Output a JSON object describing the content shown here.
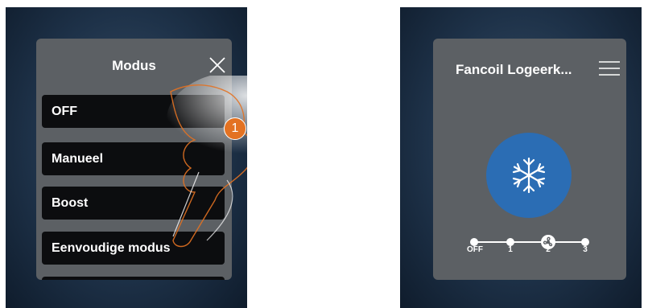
{
  "left_screen": {
    "title": "Modus",
    "items": [
      {
        "label": "OFF"
      },
      {
        "label": "Manueel"
      },
      {
        "label": "Boost"
      },
      {
        "label": "Eenvoudige modus"
      }
    ],
    "step_badge": "1",
    "icons": {
      "close": "close-icon",
      "hand": "pointing-hand-icon"
    }
  },
  "right_screen": {
    "title": "Fancoil Logeerk...",
    "mode_icon": "snowflake-icon",
    "menu_icon": "hamburger-menu-icon",
    "speed_labels": [
      "OFF",
      "1",
      "2",
      "3"
    ],
    "selected_speed": "2",
    "colors": {
      "mode_circle": "#2b6db4",
      "panel": "#5c6064",
      "badge": "#e37222"
    }
  }
}
